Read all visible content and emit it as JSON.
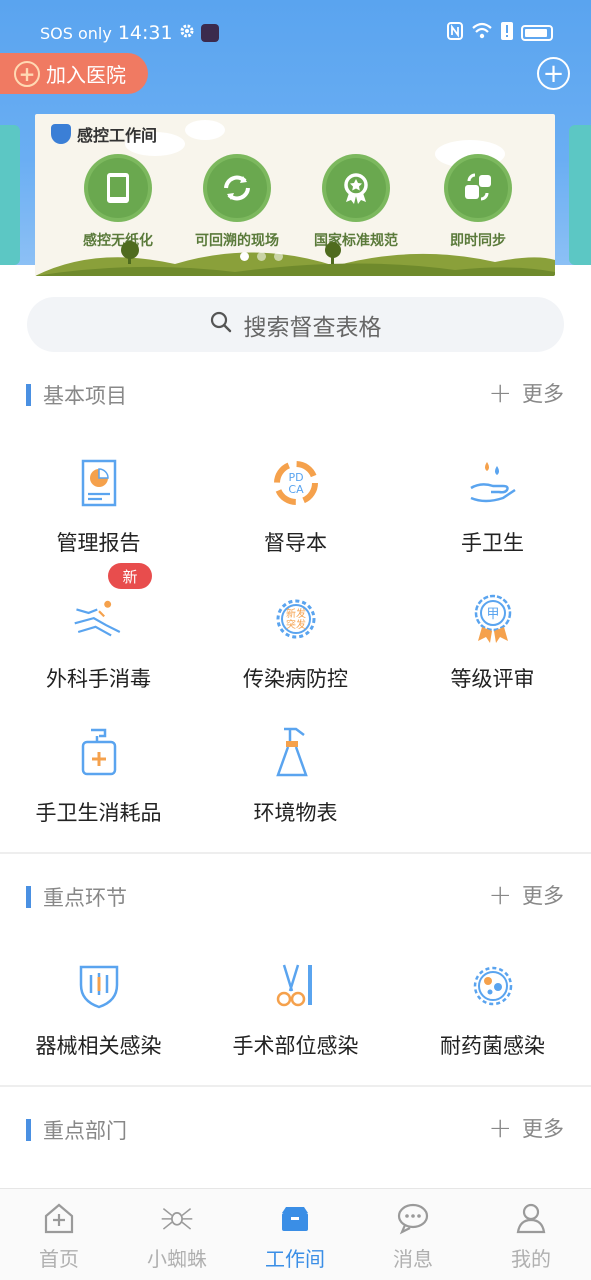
{
  "status_bar": {
    "carrier": "SOS only",
    "time": "14:31"
  },
  "header": {
    "join_label": "加入医院"
  },
  "banner": {
    "logo_text": "感控工作间",
    "features": [
      {
        "label": "感控无纸化",
        "icon": "tablet-icon"
      },
      {
        "label": "可回溯的现场",
        "icon": "refresh-icon"
      },
      {
        "label": "国家标准规范",
        "icon": "award-icon"
      },
      {
        "label": "即时同步",
        "icon": "sync-icon"
      }
    ]
  },
  "search": {
    "placeholder": "搜索督查表格"
  },
  "sections": {
    "basic": {
      "title": "基本项目",
      "more": "更多",
      "items": [
        {
          "label": "管理报告",
          "icon": "report-icon"
        },
        {
          "label": "督导本",
          "icon": "pdca-icon"
        },
        {
          "label": "手卫生",
          "icon": "hand-hygiene-icon"
        },
        {
          "label": "外科手消毒",
          "icon": "surgical-hand-icon",
          "badge": "新"
        },
        {
          "label": "传染病防控",
          "icon": "virus-icon",
          "icon_text": "新发突发"
        },
        {
          "label": "等级评审",
          "icon": "grade-badge-icon",
          "icon_text": "甲"
        },
        {
          "label": "手卫生消耗品",
          "icon": "sanitizer-icon"
        },
        {
          "label": "环境物表",
          "icon": "spray-bottle-icon"
        }
      ]
    },
    "key_links": {
      "title": "重点环节",
      "more": "更多",
      "items": [
        {
          "label": "器械相关感染",
          "icon": "shield-icon"
        },
        {
          "label": "手术部位感染",
          "icon": "scissors-icon"
        },
        {
          "label": "耐药菌感染",
          "icon": "bacteria-icon"
        }
      ]
    },
    "key_departments": {
      "title": "重点部门",
      "more": "更多"
    }
  },
  "tabbar": {
    "items": [
      {
        "label": "首页",
        "icon": "home-icon"
      },
      {
        "label": "小蜘蛛",
        "icon": "spider-icon"
      },
      {
        "label": "工作间",
        "icon": "workspace-icon",
        "active": true
      },
      {
        "label": "消息",
        "icon": "message-icon"
      },
      {
        "label": "我的",
        "icon": "profile-icon"
      }
    ]
  },
  "colors": {
    "primary": "#3a8ee6",
    "header": "#5aa4ef",
    "join_button": "#f07a62",
    "badge_red": "#e84d4d"
  }
}
